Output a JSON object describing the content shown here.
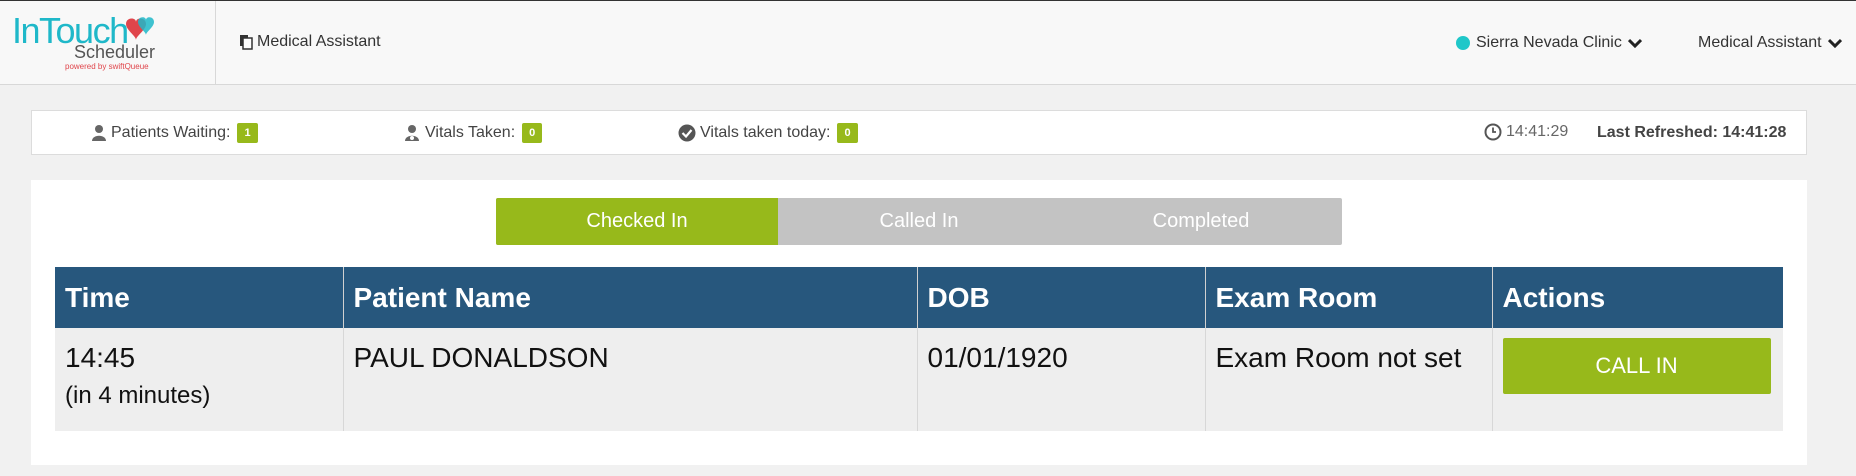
{
  "header": {
    "logo_main": "InTouch",
    "logo_sub": "Scheduler",
    "logo_powered": "powered by swiftQueue",
    "role_label": "Medical Assistant",
    "clinic_label": "Sierra Nevada Clinic",
    "user_menu_label": "Medical Assistant",
    "clinic_status_color": "#1fc7c9"
  },
  "stats": {
    "patients_waiting_label": "Patients Waiting:",
    "patients_waiting_count": "1",
    "vitals_taken_label": "Vitals Taken:",
    "vitals_taken_count": "0",
    "vitals_today_label": "Vitals taken today:",
    "vitals_today_count": "0",
    "clock_time": "14:41:29",
    "last_refreshed": "Last Refreshed: 14:41:28"
  },
  "tabs": [
    {
      "label": "Checked In",
      "active": true
    },
    {
      "label": "Called In",
      "active": false
    },
    {
      "label": "Completed",
      "active": false
    }
  ],
  "table": {
    "columns": [
      "Time",
      "Patient Name",
      "DOB",
      "Exam Room",
      "Actions"
    ],
    "rows": [
      {
        "time": "14:45",
        "time_relative": "(in 4 minutes)",
        "patient_name": "PAUL DONALDSON",
        "dob": "01/01/1920",
        "exam_room": "Exam Room not set",
        "action_label": "CALL IN"
      }
    ]
  },
  "colors": {
    "accent_green": "#97b91b",
    "header_blue": "#27577d",
    "brand_teal": "#1fb8c9"
  }
}
